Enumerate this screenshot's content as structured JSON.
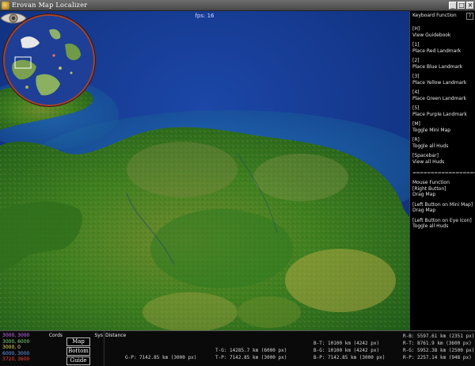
{
  "window": {
    "title": "Erovan Map Localizer",
    "controls": [
      "_",
      "□",
      "×"
    ]
  },
  "map": {
    "fps": "fps: 16"
  },
  "keyboard_panel": {
    "heading": "Keyboard Function",
    "help": "?",
    "items": [
      {
        "key": "[H]",
        "action": "View Guidebook"
      },
      {
        "key": "[1]",
        "action": "Place Red Landmark"
      },
      {
        "key": "[2]",
        "action": "Place Blue Landmark"
      },
      {
        "key": "[3]",
        "action": "Place Yellow Landmark"
      },
      {
        "key": "[4]",
        "action": "Place Green Landmark"
      },
      {
        "key": "[5]",
        "action": "Place Purple Landmark"
      },
      {
        "key": "[M]",
        "action": "Toggle Mini Map"
      },
      {
        "key": "[R]",
        "action": "Toggle all Huds"
      },
      {
        "key": "[Spacebar]",
        "action": "View all Huds"
      }
    ],
    "divider": "========================",
    "mouse_heading": "Mouse Function",
    "mouse_items": [
      {
        "key": "[Right Button]",
        "action": "Drag Map"
      },
      {
        "key": "[Left Button on Mini Map]",
        "action": "Drag Map"
      },
      {
        "key": "[Left Button on Eye Icon]",
        "action": "Toggle all Huds"
      }
    ]
  },
  "bottom": {
    "cords_label": "Cords",
    "cords": [
      {
        "text": "3000, 3000",
        "color": "#d070ff"
      },
      {
        "text": "3000, 6000",
        "color": "#80e080"
      },
      {
        "text": "3000, 0",
        "color": "#f0e060"
      },
      {
        "text": "6000, 3000",
        "color": "#6aa0ff"
      },
      {
        "text": "3720, 3600",
        "color": "#ff4040"
      }
    ],
    "sys_label": "Sys",
    "buttons": {
      "map": "Map",
      "bottom": "Bottom",
      "guide": "Guide"
    },
    "distance_label": "Distance",
    "distances": {
      "rb": "R-B:  5597.61 km  (2351 px)",
      "rt": "R-T:  8761.9 km  (3600 px)",
      "rg": "R-G:  5952.38 km  (2500 px)",
      "rp": "R-P:  2257.14 km  (948 px)",
      "bt": "B-T:  10100 km  (4242 px)",
      "bg": "B-G:  10100 km  (4242 px)",
      "bp": "B-P:  7142.85 km  (3000 px)",
      "tg": "T-G:  14285.7 km  (6000 px)",
      "tp": "T-P:  7142.85 km  (3000 px)",
      "gp": "G-P:  7142.85 km  (3000 px)"
    }
  }
}
